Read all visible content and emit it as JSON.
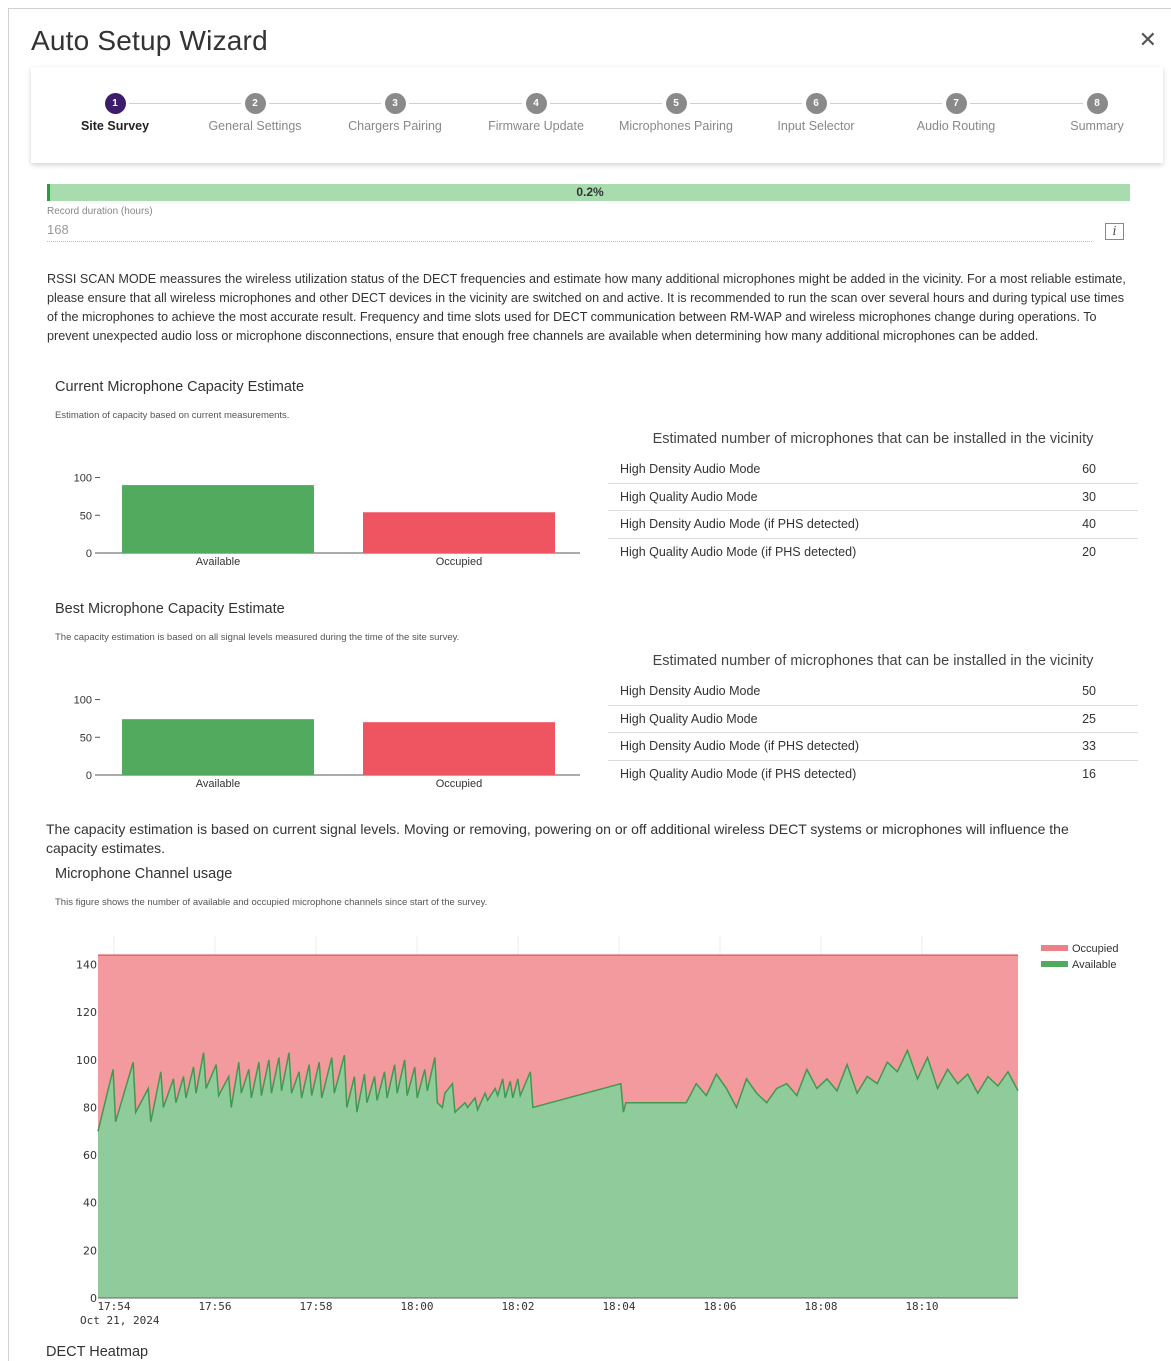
{
  "window": {
    "title": "Auto Setup Wizard",
    "close_icon": "close-icon"
  },
  "steps": [
    {
      "num": "1",
      "label": "Site Survey",
      "active": true
    },
    {
      "num": "2",
      "label": "General Settings"
    },
    {
      "num": "3",
      "label": "Chargers Pairing"
    },
    {
      "num": "4",
      "label": "Firmware Update"
    },
    {
      "num": "5",
      "label": "Microphones Pairing"
    },
    {
      "num": "6",
      "label": "Input Selector"
    },
    {
      "num": "7",
      "label": "Audio Routing"
    },
    {
      "num": "8",
      "label": "Summary"
    }
  ],
  "progress": {
    "label": "0.2%",
    "value": 0.2
  },
  "record_duration": {
    "label": "Record duration (hours)",
    "value": "168"
  },
  "description": "RSSI SCAN MODE meassures the wireless utilization status of the DECT frequencies and estimate how many additional microphones might be added in the vicinity. For a most reliable estimate, please ensure that all wireless microphones and other DECT devices in the vicinity are switched on and active. It is recommended to run the scan over several hours and during typical use times of the microphones to achieve the most accurate result. Frequency and time slots used for DECT communication between RM-WAP and wireless microphones change during operations. To prevent unexpected audio loss or microphone disconnections, ensure that enough free channels are available when determining how many additional microphones can be added.",
  "current": {
    "title": "Current Microphone Capacity Estimate",
    "subtitle": "Estimation of capacity based on current measurements.",
    "table_heading": "Estimated number of microphones that can be installed in the vicinity",
    "rows": [
      {
        "label": "High Density Audio Mode",
        "value": "60"
      },
      {
        "label": "High Quality Audio Mode",
        "value": "30"
      },
      {
        "label": "High Density Audio Mode (if PHS detected)",
        "value": "40"
      },
      {
        "label": "High Quality Audio Mode (if PHS detected)",
        "value": "20"
      }
    ]
  },
  "best": {
    "title": "Best Microphone Capacity Estimate",
    "subtitle": "The capacity estimation is based on all signal levels measured during the time of the site survey.",
    "table_heading": "Estimated number of microphones that can be installed in the vicinity",
    "rows": [
      {
        "label": "High Density Audio Mode",
        "value": "50"
      },
      {
        "label": "High Quality Audio Mode",
        "value": "25"
      },
      {
        "label": "High Density Audio Mode (if PHS detected)",
        "value": "33"
      },
      {
        "label": "High Quality Audio Mode (if PHS detected)",
        "value": "16"
      }
    ]
  },
  "note": "The capacity estimation is based on current signal levels. Moving or removing, powering on or off additional wireless DECT systems or microphones will influence the capacity estimates.",
  "channel_usage": {
    "title": "Microphone Channel usage",
    "subtitle": "This figure shows the number of available and occupied microphone channels since start of the survey."
  },
  "heatmap_title": "DECT Heatmap",
  "colors": {
    "available": "#52aa5e",
    "occupied": "#ef5461",
    "available_area": "#8fcb9b",
    "occupied_area": "#f39a9f",
    "accent": "#3d1d6b"
  },
  "chart_data": [
    {
      "type": "bar",
      "categories": [
        "Available",
        "Occupied"
      ],
      "values": [
        90,
        54
      ],
      "ylim": [
        0,
        110
      ],
      "yticks": [
        0,
        50,
        100
      ]
    },
    {
      "type": "bar",
      "categories": [
        "Available",
        "Occupied"
      ],
      "values": [
        74,
        70
      ],
      "ylim": [
        0,
        110
      ],
      "yticks": [
        0,
        50,
        100
      ]
    },
    {
      "type": "area",
      "x_ticks": [
        "17:54",
        "17:56",
        "17:58",
        "18:00",
        "18:02",
        "18:04",
        "18:06",
        "18:08",
        "18:10"
      ],
      "x_sublabel": "Oct 21, 2024",
      "yticks": [
        0,
        20,
        40,
        60,
        80,
        100,
        120,
        140
      ],
      "ylim": [
        0,
        152
      ],
      "total": 144,
      "legend": [
        "Occupied",
        "Available"
      ],
      "series": [
        {
          "name": "Available",
          "x_minutes": [
            0,
            0.3,
            0.35,
            0.7,
            0.75,
            1.0,
            1.05,
            1.25,
            1.3,
            1.5,
            1.55,
            1.7,
            1.75,
            1.9,
            1.95,
            2.1,
            2.15,
            2.35,
            2.4,
            2.6,
            2.65,
            2.8,
            2.85,
            3.0,
            3.05,
            3.2,
            3.25,
            3.4,
            3.45,
            3.6,
            3.65,
            3.8,
            3.85,
            4.0,
            4.05,
            4.2,
            4.25,
            4.4,
            4.45,
            4.65,
            4.7,
            4.9,
            4.95,
            5.1,
            5.15,
            5.3,
            5.35,
            5.5,
            5.55,
            5.7,
            5.75,
            5.9,
            5.95,
            6.1,
            6.15,
            6.3,
            6.35,
            6.5,
            6.55,
            6.7,
            6.75,
            6.85,
            6.9,
            7.05,
            7.1,
            7.3,
            7.35,
            7.5,
            7.55,
            7.7,
            7.75,
            7.9,
            7.95,
            8.05,
            8.1,
            8.2,
            8.25,
            8.35,
            8.4,
            8.6,
            8.65,
            10.4,
            10.45,
            10.5,
            11.6,
            11.7,
            11.9,
            12.1,
            12.3,
            12.5,
            12.7,
            12.9,
            13.1,
            13.3,
            13.5,
            13.7,
            13.9,
            14.1,
            14.3,
            14.5,
            14.7,
            14.9,
            15.1,
            15.3,
            15.5,
            15.7,
            15.9,
            16.1,
            16.3,
            16.5,
            16.7,
            16.9,
            17.1,
            17.3,
            17.5,
            17.7,
            17.9,
            18.1,
            18.3
          ],
          "values": [
            70,
            96,
            74,
            99,
            78,
            88,
            74,
            95,
            80,
            92,
            82,
            93,
            84,
            97,
            86,
            103,
            88,
            98,
            85,
            93,
            80,
            99,
            86,
            96,
            84,
            99,
            85,
            100,
            86,
            101,
            87,
            103,
            86,
            95,
            84,
            98,
            85,
            99,
            84,
            101,
            86,
            102,
            80,
            93,
            78,
            94,
            82,
            93,
            83,
            95,
            84,
            98,
            86,
            100,
            85,
            97,
            84,
            96,
            87,
            101,
            82,
            80,
            86,
            90,
            78,
            82,
            80,
            84,
            79,
            86,
            83,
            88,
            85,
            92,
            84,
            91,
            84,
            92,
            85,
            95,
            80,
            90,
            78,
            82,
            82,
            82,
            90,
            85,
            94,
            88,
            80,
            92,
            86,
            82,
            88,
            90,
            85,
            96,
            88,
            92,
            87,
            98,
            86,
            93,
            90,
            99,
            95,
            104,
            92,
            101,
            88,
            96,
            90,
            94,
            86,
            93,
            89,
            95,
            87,
            91,
            88
          ]
        },
        {
          "name": "Occupied",
          "values_note": "complement to total 144"
        }
      ]
    }
  ]
}
